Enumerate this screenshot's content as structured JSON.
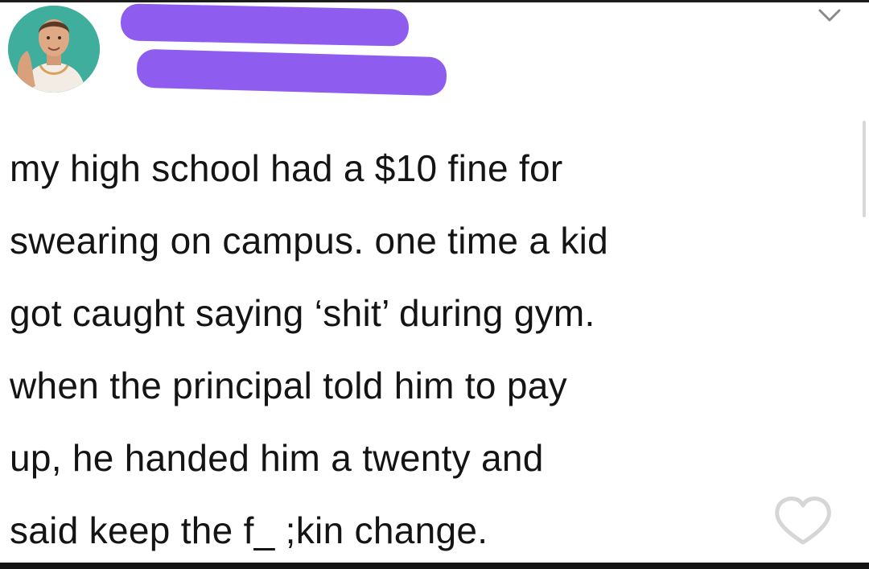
{
  "tweet": {
    "text": "my high school had a $10 fine for\nswearing on campus. one time a kid\ngot caught saying ‘shit’ during gym.\nwhen the principal told him to pay\nup, he handed him a twenty and\nsaid keep the f_ ;kin change."
  },
  "icons": {
    "menu": "chevron-down-icon",
    "like": "heart-outline-icon"
  },
  "colors": {
    "redaction": "#8f5cf0",
    "avatar_bg": "#3fae9d",
    "text": "#141414",
    "background": "#ffffff"
  }
}
